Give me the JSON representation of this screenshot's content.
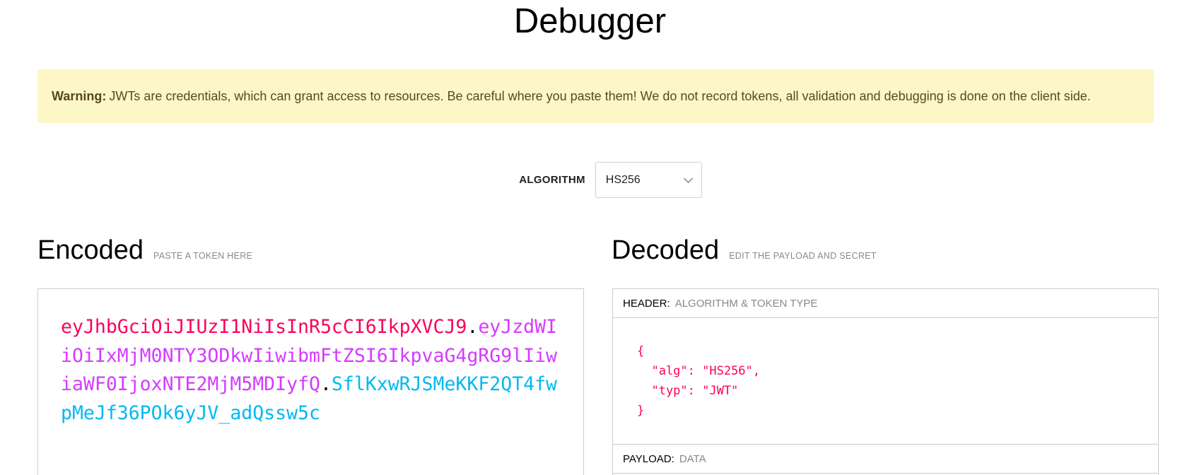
{
  "page": {
    "title": "Debugger"
  },
  "warning": {
    "label": "Warning:",
    "text": "JWTs are credentials, which can grant access to resources. Be careful where you paste them! We do not record tokens, all validation and debugging is done on the client side."
  },
  "algorithm": {
    "label": "ALGORITHM",
    "selected": "HS256"
  },
  "encoded": {
    "heading": "Encoded",
    "hint": "PASTE A TOKEN HERE",
    "token_header": "eyJhbGciOiJIUzI1NiIsInR5cCI6IkpXVCJ9",
    "token_payload": "eyJzdWIiOiIxMjM0NTY3ODkwIiwibmFtZSI6IkpvaG4gRG9lIiwiaWF0IjoxNTE2MjM5MDIyfQ",
    "token_signature": "SflKxwRJSMeKKF2QT4fwpMeJf36POk6yJV_adQssw5c",
    "dot": "."
  },
  "decoded": {
    "heading": "Decoded",
    "hint": "EDIT THE PAYLOAD AND SECRET",
    "header_panel": {
      "label": "HEADER:",
      "desc": "ALGORITHM & TOKEN TYPE",
      "json_text": "{\n  \"alg\": \"HS256\",\n  \"typ\": \"JWT\"\n}"
    },
    "payload_panel": {
      "label": "PAYLOAD:",
      "desc": "DATA"
    }
  },
  "colors": {
    "header_token": "#fb015b",
    "payload_token": "#d63aff",
    "signature_token": "#00b9f1",
    "warning_bg": "#fdf7c8"
  }
}
